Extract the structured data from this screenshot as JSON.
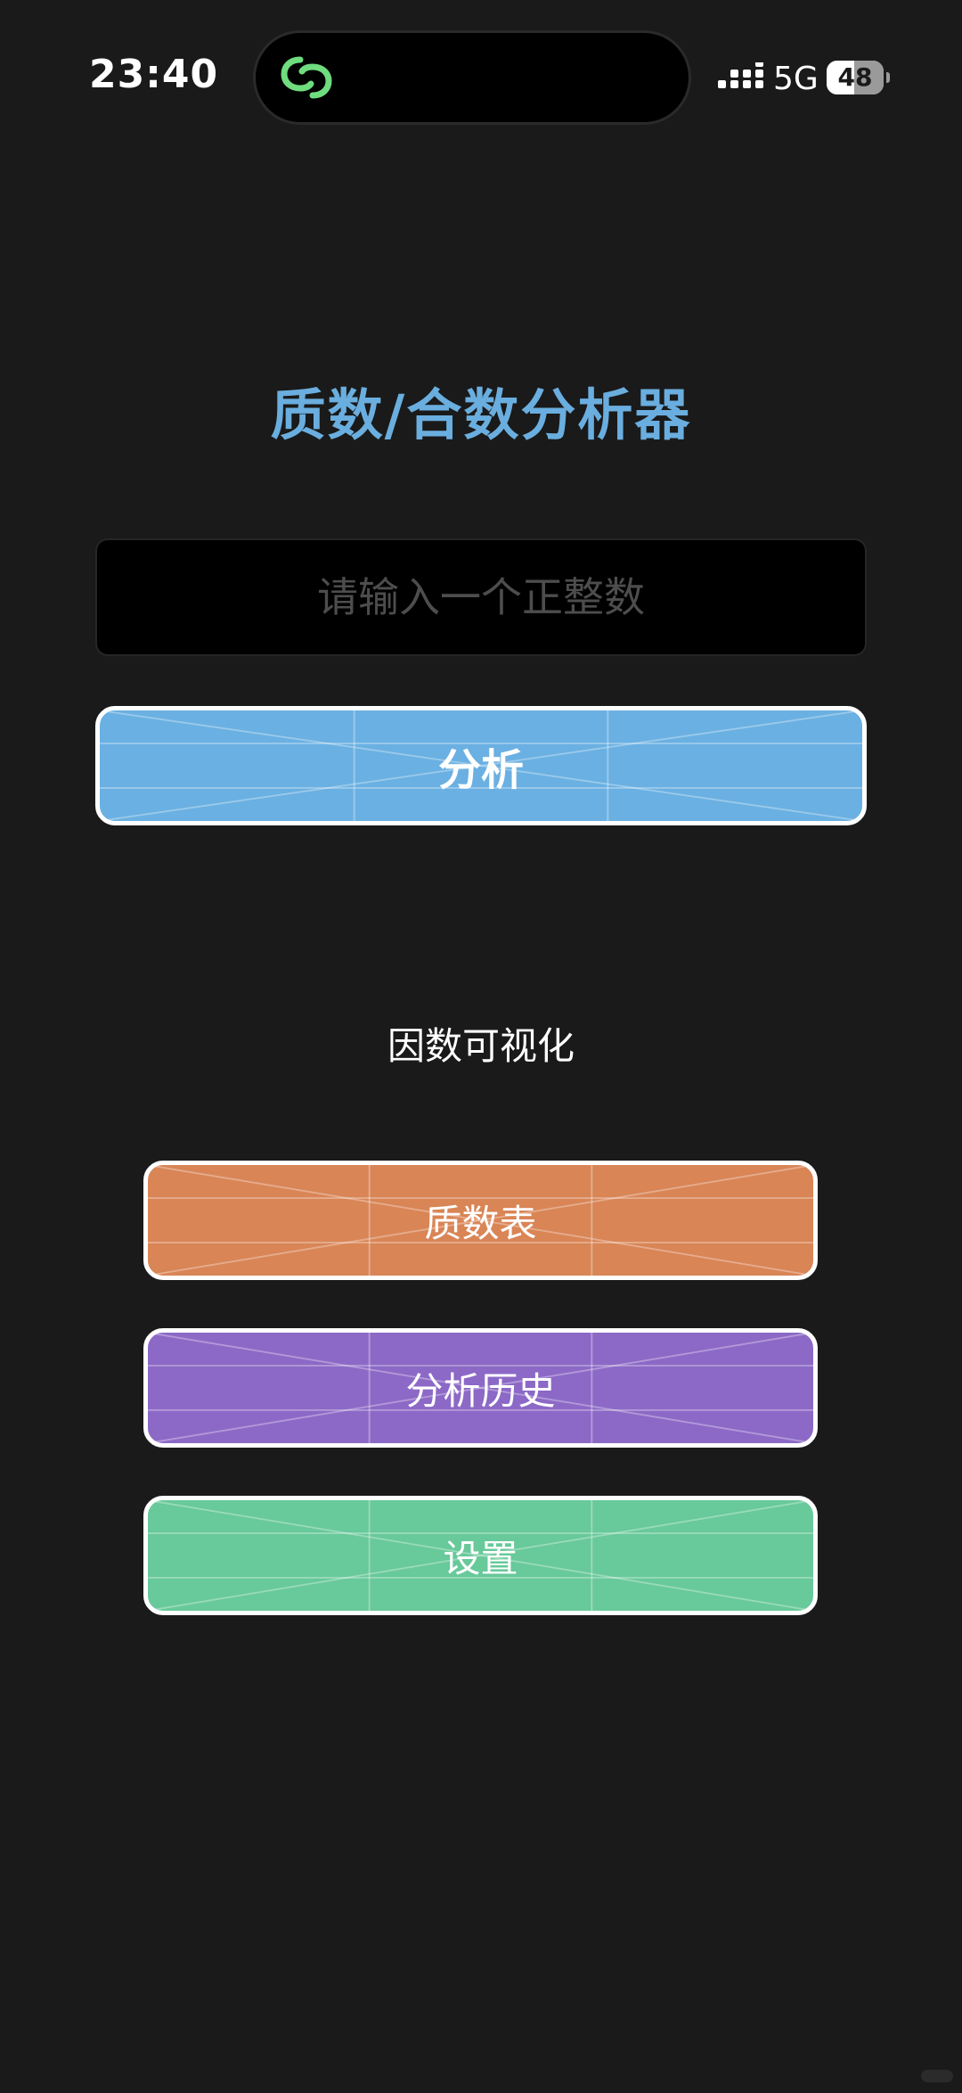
{
  "status_bar": {
    "time": "23:40",
    "network": "5G",
    "battery_percent": "48",
    "battery_level": 0.48,
    "app_icon": "link-loop-icon",
    "signal_icon": "cellular-signal-icon"
  },
  "title": "质数/合数分析器",
  "input": {
    "placeholder": "请输入一个正整数",
    "value": ""
  },
  "analyze_button": {
    "label": "分析",
    "color": "#6ab0e2"
  },
  "section_label": "因数可视化",
  "menu": {
    "prime_table": {
      "label": "质数表",
      "color": "#d98556"
    },
    "history": {
      "label": "分析历史",
      "color": "#8c69c6"
    },
    "settings": {
      "label": "设置",
      "color": "#68c99a"
    }
  },
  "colors": {
    "background": "#1a1a1a",
    "title": "#6aaedf",
    "app_icon": "#6fdc7e"
  }
}
